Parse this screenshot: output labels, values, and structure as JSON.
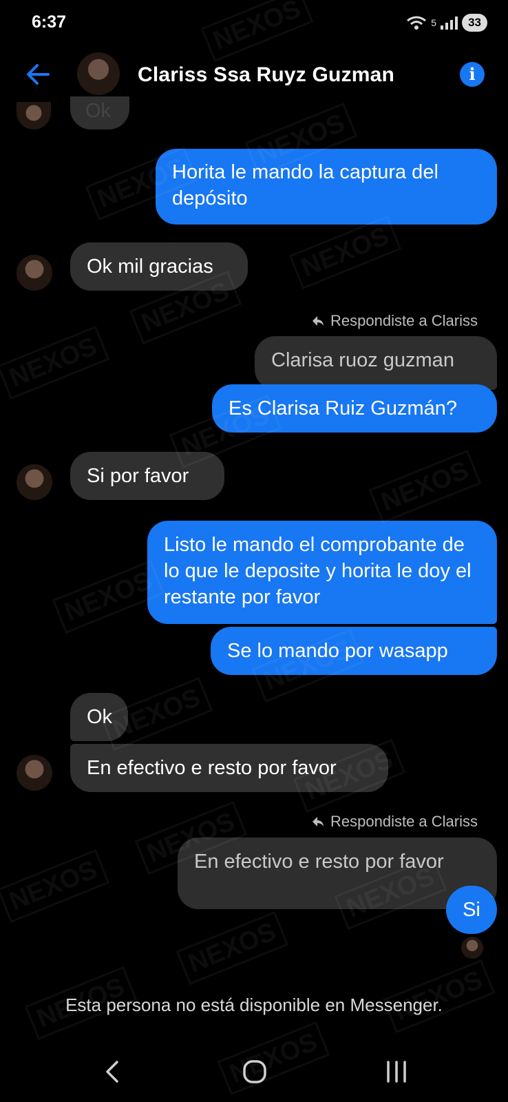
{
  "status_bar": {
    "time": "6:37",
    "wifi_label": "5",
    "battery": "33"
  },
  "header": {
    "contact_name": "Clariss Ssa Ruyz Guzman",
    "info_icon": "i"
  },
  "messages": {
    "partial_top": "Ok",
    "m1": "Horita le mando la captura del depósito",
    "m2": "Ok mil gracias",
    "reply1_label": "Respondiste a Clariss",
    "reply1_quote": "Clarisa ruoz guzman",
    "m3": "Es Clarisa Ruiz Guzmán?",
    "m4": "Si por favor",
    "m5": "Listo le mando el comprobante de lo que le deposite y horita le doy el restante por favor",
    "m6": "Se lo mando por wasapp",
    "m7": "Ok",
    "m8": "En efectivo e resto por favor",
    "reply2_label": "Respondiste a Clariss",
    "reply2_quote": "En efectivo e resto por favor",
    "m9": "Si"
  },
  "footer": {
    "unavailable_text": "Esta persona no está disponible en Messenger."
  },
  "watermark": "NEXOS"
}
